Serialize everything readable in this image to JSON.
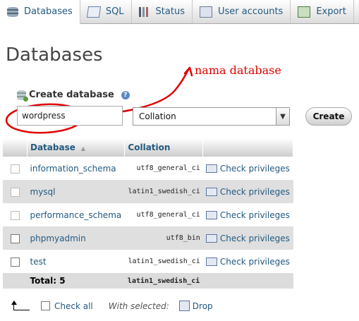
{
  "tabs": [
    {
      "label": "Databases",
      "icon": "database-icon",
      "active": true
    },
    {
      "label": "SQL",
      "icon": "sql-icon"
    },
    {
      "label": "Status",
      "icon": "status-icon"
    },
    {
      "label": "User accounts",
      "icon": "user-accounts-icon"
    },
    {
      "label": "Export",
      "icon": "export-icon"
    }
  ],
  "page": {
    "title": "Databases"
  },
  "annotation": {
    "text": "nama database",
    "color": "#e00000"
  },
  "create": {
    "label": "Create database",
    "db_name_value": "wordpress",
    "collation_value": "Collation",
    "button_label": "Create"
  },
  "table": {
    "headers": {
      "database": "Database",
      "collation": "Collation"
    },
    "rows": [
      {
        "name": "information_schema",
        "collation": "utf8_general_ci",
        "action": "Check privileges"
      },
      {
        "name": "mysql",
        "collation": "latin1_swedish_ci",
        "action": "Check privileges"
      },
      {
        "name": "performance_schema",
        "collation": "utf8_general_ci",
        "action": "Check privileges"
      },
      {
        "name": "phpmyadmin",
        "collation": "utf8_bin",
        "action": "Check privileges"
      },
      {
        "name": "test",
        "collation": "latin1_swedish_ci",
        "action": "Check privileges"
      }
    ],
    "total_label": "Total: 5",
    "total_collation": "latin1_swedish_ci"
  },
  "footer": {
    "check_all": "Check all",
    "with_selected": "With selected:",
    "drop": "Drop"
  },
  "colors": {
    "link": "#235a81",
    "row_alt": "#dfdfdf"
  }
}
